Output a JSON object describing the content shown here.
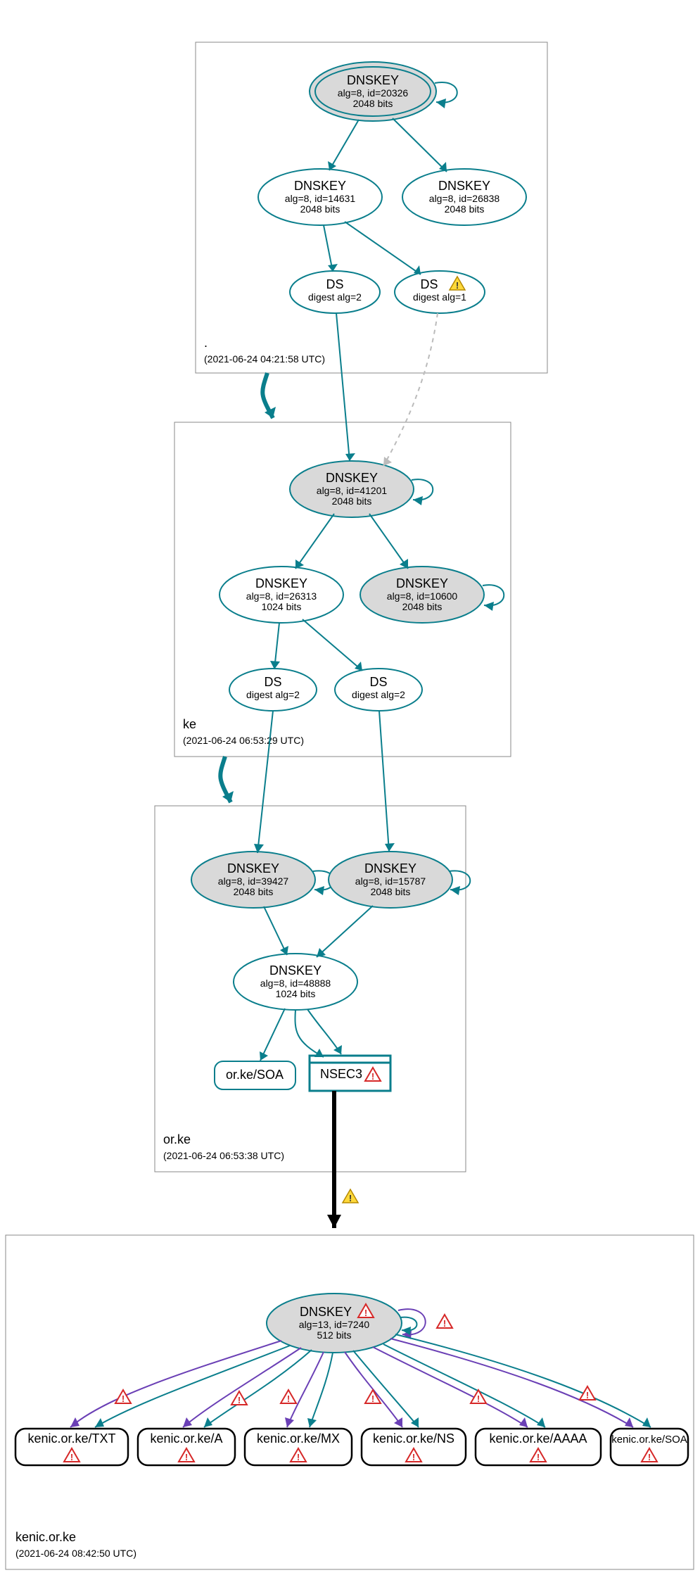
{
  "zones": {
    "root": {
      "name": ".",
      "ts": "(2021-06-24 04:21:58 UTC)"
    },
    "ke": {
      "name": "ke",
      "ts": "(2021-06-24 06:53:29 UTC)"
    },
    "orke": {
      "name": "or.ke",
      "ts": "(2021-06-24 06:53:38 UTC)"
    },
    "kenic": {
      "name": "kenic.or.ke",
      "ts": "(2021-06-24 08:42:50 UTC)"
    }
  },
  "nodes": {
    "r_ksk": {
      "l1": "DNSKEY",
      "l2": "alg=8, id=20326",
      "l3": "2048 bits"
    },
    "r_zsk": {
      "l1": "DNSKEY",
      "l2": "alg=8, id=14631",
      "l3": "2048 bits"
    },
    "r_zsk2": {
      "l1": "DNSKEY",
      "l2": "alg=8, id=26838",
      "l3": "2048 bits"
    },
    "r_ds1": {
      "l1": "DS",
      "l2": "digest alg=2"
    },
    "r_ds2": {
      "l1": "DS",
      "l2": "digest alg=1"
    },
    "ke_ksk": {
      "l1": "DNSKEY",
      "l2": "alg=8, id=41201",
      "l3": "2048 bits"
    },
    "ke_zsk": {
      "l1": "DNSKEY",
      "l2": "alg=8, id=26313",
      "l3": "1024 bits"
    },
    "ke_zsk2": {
      "l1": "DNSKEY",
      "l2": "alg=8, id=10600",
      "l3": "2048 bits"
    },
    "ke_ds1": {
      "l1": "DS",
      "l2": "digest alg=2"
    },
    "ke_ds2": {
      "l1": "DS",
      "l2": "digest alg=2"
    },
    "ok_ksk1": {
      "l1": "DNSKEY",
      "l2": "alg=8, id=39427",
      "l3": "2048 bits"
    },
    "ok_ksk2": {
      "l1": "DNSKEY",
      "l2": "alg=8, id=15787",
      "l3": "2048 bits"
    },
    "ok_zsk": {
      "l1": "DNSKEY",
      "l2": "alg=8, id=48888",
      "l3": "1024 bits"
    },
    "ok_soa": {
      "l1": "or.ke/SOA"
    },
    "ok_nsec": {
      "l1": "NSEC3"
    },
    "kn_key": {
      "l1": "DNSKEY",
      "l2": "alg=13, id=7240",
      "l3": "512 bits"
    },
    "kn_txt": {
      "l1": "kenic.or.ke/TXT"
    },
    "kn_a": {
      "l1": "kenic.or.ke/A"
    },
    "kn_mx": {
      "l1": "kenic.or.ke/MX"
    },
    "kn_ns": {
      "l1": "kenic.or.ke/NS"
    },
    "kn_aaaa": {
      "l1": "kenic.or.ke/AAAA"
    },
    "kn_soa": {
      "l1": "kenic.or.ke/SOA"
    }
  }
}
